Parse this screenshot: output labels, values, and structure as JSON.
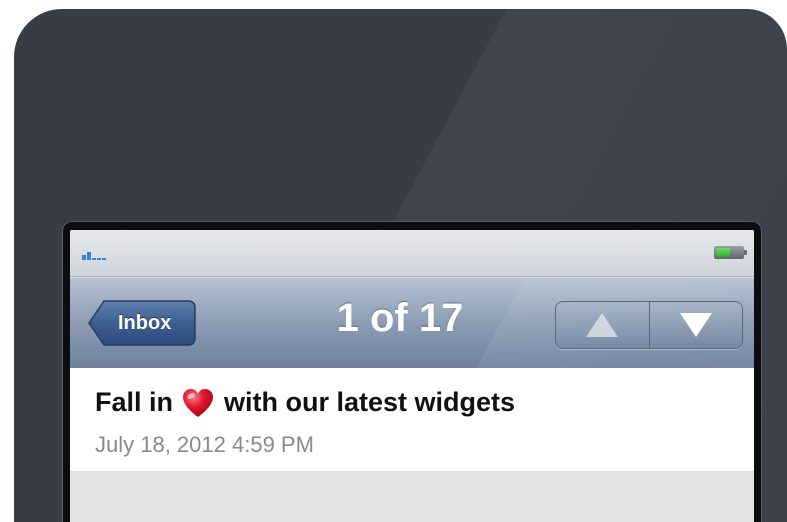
{
  "status_bar": {
    "signal_icon": "signal-bars-icon",
    "battery_icon": "battery-icon",
    "battery_level": 0.55,
    "accent_color": "#3c7fd8"
  },
  "nav_bar": {
    "back_label": "Inbox",
    "title": "1 of 17",
    "prev_icon": "arrow-up-icon",
    "next_icon": "arrow-down-icon"
  },
  "message": {
    "subject_before": "Fall in",
    "subject_icon": "heart-icon",
    "subject_after": "with our latest widgets",
    "date": "July 18, 2012 4:59 PM"
  },
  "colors": {
    "device_body": "#373c45",
    "nav_gradient_top": "#b5c2d3",
    "nav_gradient_bottom": "#6d819e",
    "heart": "#e0142b"
  }
}
